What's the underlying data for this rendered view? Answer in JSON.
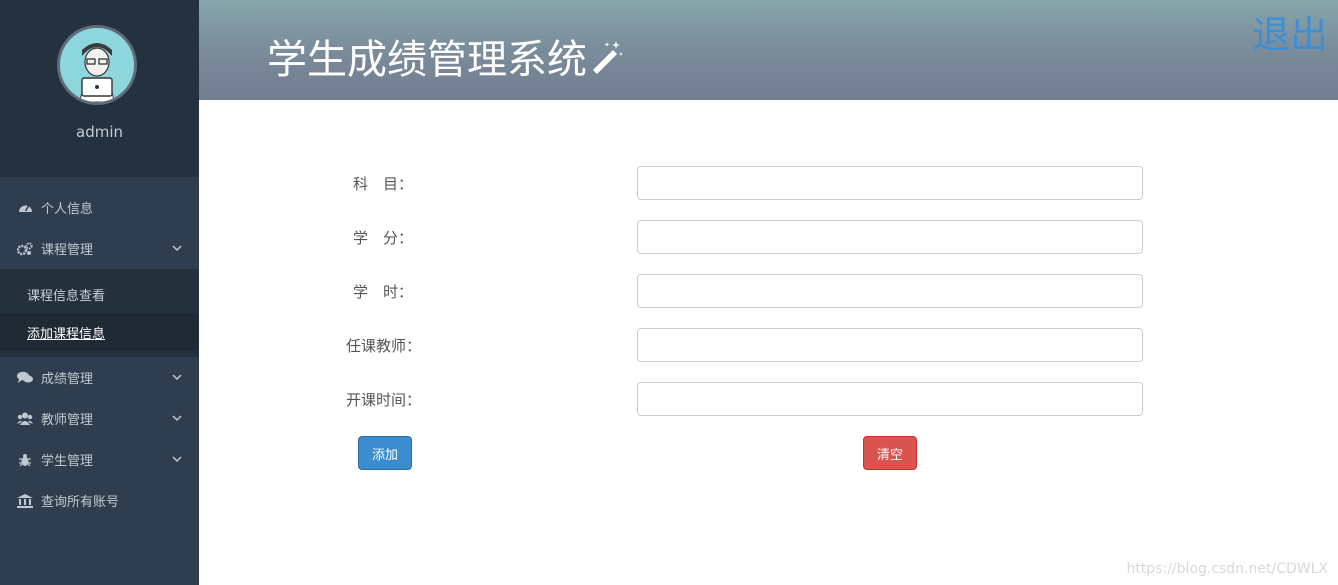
{
  "sidebar": {
    "username": "admin",
    "menu": [
      {
        "label": "个人信息",
        "icon": "dashboard-icon"
      },
      {
        "label": "课程管理",
        "icon": "gears-icon",
        "expanded": true,
        "children": [
          {
            "label": "课程信息查看",
            "active": false
          },
          {
            "label": "添加课程信息",
            "active": true
          }
        ]
      },
      {
        "label": "成绩管理",
        "icon": "comments-icon"
      },
      {
        "label": "教师管理",
        "icon": "users-icon"
      },
      {
        "label": "学生管理",
        "icon": "bug-icon"
      },
      {
        "label": "查询所有账号",
        "icon": "bank-icon"
      }
    ]
  },
  "header": {
    "title": "学生成绩管理系统",
    "logout": "退出"
  },
  "form": {
    "fields": [
      {
        "label": "科　目：",
        "value": ""
      },
      {
        "label": "学　分：",
        "value": ""
      },
      {
        "label": "学　时：",
        "value": ""
      },
      {
        "label": "任课教师：",
        "value": ""
      },
      {
        "label": "开课时间：",
        "value": ""
      }
    ],
    "add_button": "添加",
    "clear_button": "清空"
  },
  "watermark": "https://blog.csdn.net/CDWLX",
  "colors": {
    "sidebar_bg": "#2f3e4e",
    "accent_blue": "#3c8cd0",
    "danger_red": "#d9534f"
  }
}
